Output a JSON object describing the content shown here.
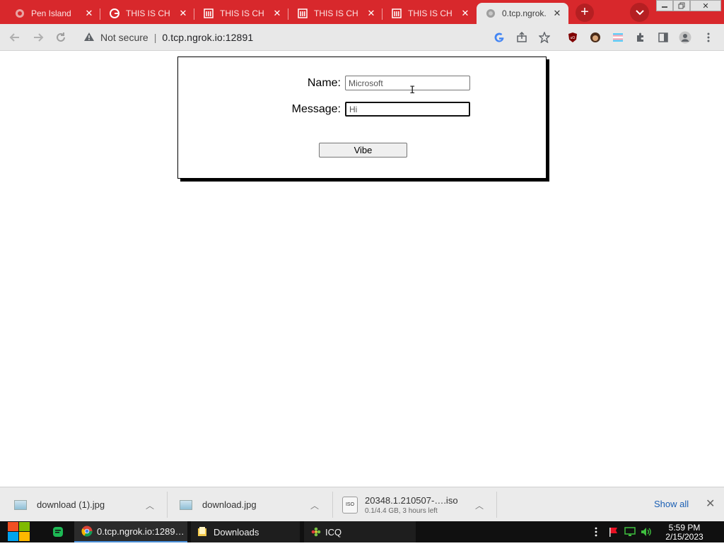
{
  "tabs": [
    {
      "title": "Pen Island",
      "favicon": "globe-icon"
    },
    {
      "title": "THIS IS CH",
      "favicon": "google-icon"
    },
    {
      "title": "THIS IS CH",
      "favicon": "museum-icon"
    },
    {
      "title": "THIS IS CH",
      "favicon": "museum-icon"
    },
    {
      "title": "THIS IS CH",
      "favicon": "museum-icon"
    },
    {
      "title": "0.tcp.ngrok.",
      "favicon": "globe-icon",
      "active": true
    }
  ],
  "address_bar": {
    "security_text": "Not secure",
    "url": "0.tcp.ngrok.io:12891"
  },
  "form": {
    "name_label": "Name:",
    "name_value": "Microsoft",
    "message_label": "Message:",
    "message_value": "Hi",
    "submit_label": "Vibe"
  },
  "downloads": {
    "items": [
      {
        "name": "download (1).jpg"
      },
      {
        "name": "download.jpg"
      },
      {
        "name": "20348.1.210507-….iso",
        "status": "0.1/4.4 GB, 3 hours left"
      }
    ],
    "show_all": "Show all"
  },
  "taskbar": {
    "items": [
      {
        "label": "0.tcp.ngrok.io:1289…"
      },
      {
        "label": "Downloads"
      },
      {
        "label": "ICQ"
      }
    ],
    "time": "5:59 PM",
    "date": "2/15/2023"
  },
  "colors": {
    "tabstrip": "#d8282c",
    "toolbar": "#e8e8e8",
    "link": "#1a5fb4"
  }
}
